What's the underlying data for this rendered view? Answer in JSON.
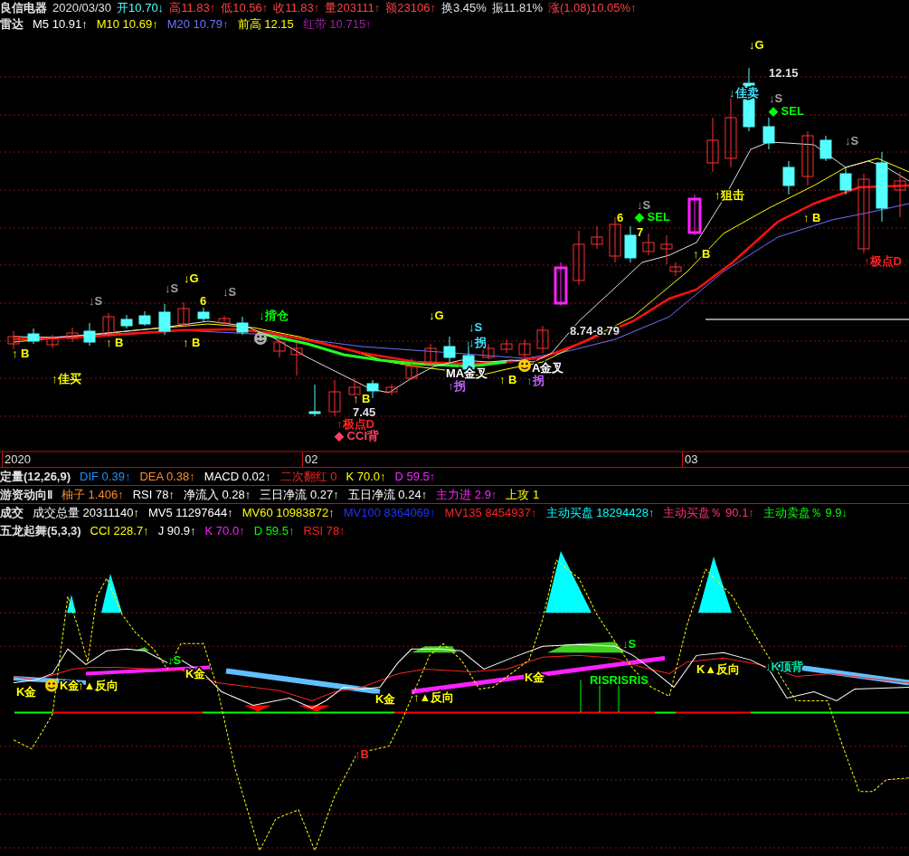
{
  "quote_bar": [
    {
      "text": "良信电器",
      "color": "#e0e0e0"
    },
    {
      "text": "2020/03/30",
      "color": "#e0e0e0"
    },
    {
      "text": "开10.70↓",
      "color": "#54ffff"
    },
    {
      "text": "高11.83↑",
      "color": "#ff4040"
    },
    {
      "text": "低10.56↑",
      "color": "#ff4040"
    },
    {
      "text": "收11.83↑",
      "color": "#ff4040"
    },
    {
      "text": "量203111↑",
      "color": "#ff4040"
    },
    {
      "text": "额23106↑",
      "color": "#ff4040"
    },
    {
      "text": "换3.45%",
      "color": "#e0e0e0"
    },
    {
      "text": "振11.81%",
      "color": "#e0e0e0"
    },
    {
      "text": "涨(1.08)10.05%↑",
      "color": "#ff4040"
    }
  ],
  "ma_bar": [
    {
      "text": "雷达",
      "color": "#e0e0e0"
    },
    {
      "text": "M5 10.91↑",
      "color": "#ffffff"
    },
    {
      "text": "M10 10.69↑",
      "color": "#ffff00"
    },
    {
      "text": "M20 10.79↑",
      "color": "#7070ff"
    },
    {
      "text": "前高 12.15",
      "color": "#ffff00"
    },
    {
      "text": "红带 10.715↑",
      "color": "#a020a0"
    }
  ],
  "main_chart": {
    "annotations": [
      {
        "text": "↓G",
        "color": "#ffff00"
      },
      {
        "text": "12.15",
        "color": "#e0e0e0"
      },
      {
        "text": "↓佳卖",
        "color": "#40e0ff"
      },
      {
        "text": "↓S",
        "color": "#a0a0a0"
      },
      {
        "text": "◆ SEL",
        "color": "#00ff00"
      },
      {
        "text": "↓S",
        "color": "#a0a0a0"
      },
      {
        "text": "↑狙击",
        "color": "#ffff00"
      },
      {
        "text": "6",
        "color": "#ffff00"
      },
      {
        "text": "↓S",
        "color": "#a0a0a0"
      },
      {
        "text": "◆ SEL",
        "color": "#00ff00"
      },
      {
        "text": "7",
        "color": "#ffff00"
      },
      {
        "text": "↑ B",
        "color": "#ffff00"
      },
      {
        "text": "↑ B",
        "color": "#ffff00"
      },
      {
        "text": "↑极点D",
        "color": "#ff2020"
      },
      {
        "text": "↓S",
        "color": "#a0a0a0"
      },
      {
        "text": "↓G",
        "color": "#ffff00"
      },
      {
        "text": "↓S",
        "color": "#a0a0a0"
      },
      {
        "text": "↓S",
        "color": "#a0a0a0"
      },
      {
        "text": "6",
        "color": "#ffff00"
      },
      {
        "text": "↓揹仓",
        "color": "#00ff00"
      },
      {
        "text": "↓G",
        "color": "#ffff00"
      },
      {
        "text": "↓S",
        "color": "#40e0ff"
      },
      {
        "text": "↓拐",
        "color": "#40e0ff"
      },
      {
        "text": "↑ B",
        "color": "#ffff00"
      },
      {
        "text": "↑ B",
        "color": "#ffff00"
      },
      {
        "text": "↑ B",
        "color": "#ffff00"
      },
      {
        "text": "↑佳买",
        "color": "#ffff00"
      },
      {
        "text": "MA金叉",
        "color": "#ffffff"
      },
      {
        "text": "↑拐",
        "color": "#c060ff"
      },
      {
        "text": "↑ B",
        "color": "#ffff00"
      },
      {
        "text": "A金叉",
        "color": "#ffffff"
      },
      {
        "text": "↑拐",
        "color": "#c060ff"
      },
      {
        "text": "↑ B",
        "color": "#ffff00"
      },
      {
        "text": "7.45",
        "color": "#e0e0e0"
      },
      {
        "text": "↑极点D",
        "color": "#ff2020"
      },
      {
        "text": "◆ CCI背",
        "color": "#ff4060"
      },
      {
        "text": "8.74-8.79",
        "color": "#e0e0e0"
      }
    ]
  },
  "time_axis": [
    "2020",
    "02",
    "03"
  ],
  "indicator_rows": [
    [
      {
        "text": "定量(12,26,9)",
        "color": "#e0e0e0"
      },
      {
        "text": "DIF 0.39↑",
        "color": "#1e90ff"
      },
      {
        "text": "DEA 0.38↑",
        "color": "#ff8c2a"
      },
      {
        "text": "MACD 0.02↑",
        "color": "#ffffff"
      },
      {
        "text": "二次翻红 0",
        "color": "#ff2020"
      },
      {
        "text": "K 70.0↑",
        "color": "#ffff00"
      },
      {
        "text": "D 59.5↑",
        "color": "#ff20ff"
      }
    ],
    [
      {
        "text": "游资动向Ⅱ",
        "color": "#e0e0e0"
      },
      {
        "text": "柚子 1.406↑",
        "color": "#ff8c2a"
      },
      {
        "text": "RSI 78↑",
        "color": "#ffffff"
      },
      {
        "text": "净流入 0.28↑",
        "color": "#ffffff"
      },
      {
        "text": "三日净流 0.27↑",
        "color": "#ffffff"
      },
      {
        "text": "五日净流 0.24↑",
        "color": "#ffffff"
      },
      {
        "text": "主力进 2.9↑",
        "color": "#ff20ff"
      },
      {
        "text": "上攻 1",
        "color": "#ffff00"
      }
    ],
    [
      {
        "text": "成交",
        "color": "#e0e0e0"
      },
      {
        "text": "成交总量 20311140↑",
        "color": "#ffffff"
      },
      {
        "text": "MV5 11297644↑",
        "color": "#ffffff"
      },
      {
        "text": "MV60 10983872↑",
        "color": "#ffff00"
      },
      {
        "text": "MV100 8364069↑",
        "color": "#2030ff"
      },
      {
        "text": "MV135 8454937↑",
        "color": "#ff2020"
      },
      {
        "text": "主动买盘 18294428↑",
        "color": "#00ffff"
      },
      {
        "text": "主动买盘％ 90.1↑",
        "color": "#ff3366"
      },
      {
        "text": "主动卖盘％ 9.9↓",
        "color": "#00ff00"
      }
    ],
    [
      {
        "text": "五龙起舞(5,3,3)",
        "color": "#e0e0e0"
      },
      {
        "text": "CCI 228.7↑",
        "color": "#ffff00"
      },
      {
        "text": "J 90.9↑",
        "color": "#ffffff"
      },
      {
        "text": "K 70.0↑",
        "color": "#ff20ff"
      },
      {
        "text": "D 59.5↑",
        "color": "#00ff00"
      },
      {
        "text": "RSI 78↑",
        "color": "#ff2020"
      }
    ]
  ],
  "sub_chart": {
    "annotations": [
      {
        "text": "K金",
        "color": "#ffff00"
      },
      {
        "text": "K金",
        "color": "#ffff00"
      },
      {
        "text": "↑▲反向",
        "color": "#ffff00"
      },
      {
        "text": "↓S",
        "color": "#00ff00"
      },
      {
        "text": "K金",
        "color": "#ffff00"
      },
      {
        "text": "K金",
        "color": "#ffff00"
      },
      {
        "text": "↑▲反向",
        "color": "#ffff00"
      },
      {
        "text": "K金",
        "color": "#ffff00"
      },
      {
        "text": "RISRISRIS",
        "color": "#00ff00"
      },
      {
        "text": "↓S",
        "color": "#00ff00"
      },
      {
        "text": "K▲反向",
        "color": "#ffff00"
      },
      {
        "text": "↓K顶背",
        "color": "#00e0a0"
      },
      {
        "text": "↑B",
        "color": "#ff2020"
      }
    ]
  }
}
